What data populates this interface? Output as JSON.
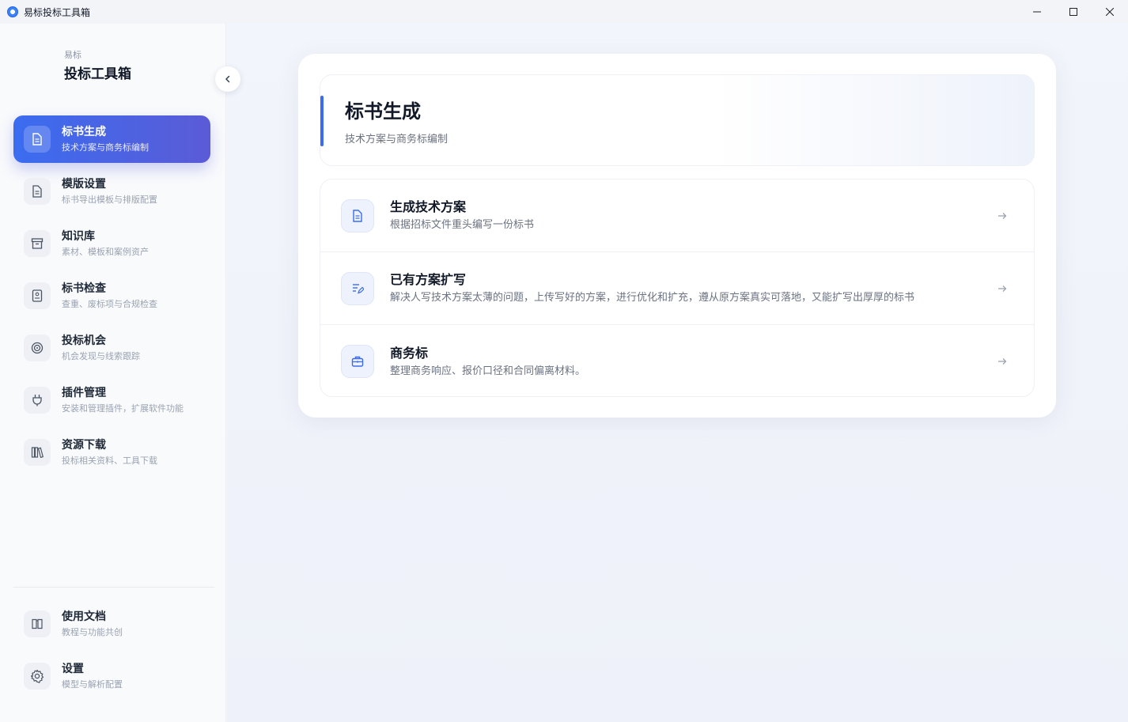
{
  "window": {
    "title": "易标投标工具箱"
  },
  "brand": {
    "small": "易标",
    "big": "投标工具箱"
  },
  "sidebar": {
    "items": [
      {
        "title": "标书生成",
        "sub": "技术方案与商务标编制",
        "icon": "document-icon",
        "active": true
      },
      {
        "title": "模版设置",
        "sub": "标书导出模板与排版配置",
        "icon": "template-icon"
      },
      {
        "title": "知识库",
        "sub": "素材、模板和案例资产",
        "icon": "archive-icon"
      },
      {
        "title": "标书检查",
        "sub": "查重、废标项与合规检查",
        "icon": "checklist-icon"
      },
      {
        "title": "投标机会",
        "sub": "机会发现与线索跟踪",
        "icon": "target-icon"
      },
      {
        "title": "插件管理",
        "sub": "安装和管理插件，扩展软件功能",
        "icon": "plug-icon"
      },
      {
        "title": "资源下载",
        "sub": "投标相关资料、工具下载",
        "icon": "library-icon"
      }
    ],
    "bottom_items": [
      {
        "title": "使用文档",
        "sub": "教程与功能共创",
        "icon": "book-icon"
      },
      {
        "title": "设置",
        "sub": "模型与解析配置",
        "icon": "gear-icon"
      }
    ]
  },
  "main": {
    "header": {
      "title": "标书生成",
      "sub": "技术方案与商务标编制"
    },
    "options": [
      {
        "title": "生成技术方案",
        "sub": "根据招标文件重头编写一份标书",
        "icon": "document-icon"
      },
      {
        "title": "已有方案扩写",
        "sub": "解决人写技术方案太薄的问题，上传写好的方案，进行优化和扩充，遵从原方案真实可落地，又能扩写出厚厚的标书",
        "icon": "edit-list-icon"
      },
      {
        "title": "商务标",
        "sub": "整理商务响应、报价口径和合同偏离材料。",
        "icon": "briefcase-icon"
      }
    ]
  },
  "colors": {
    "accent": "#3b6cf0",
    "accent_end": "#5b5bd6",
    "icon_blue": "#3b6cf0"
  }
}
